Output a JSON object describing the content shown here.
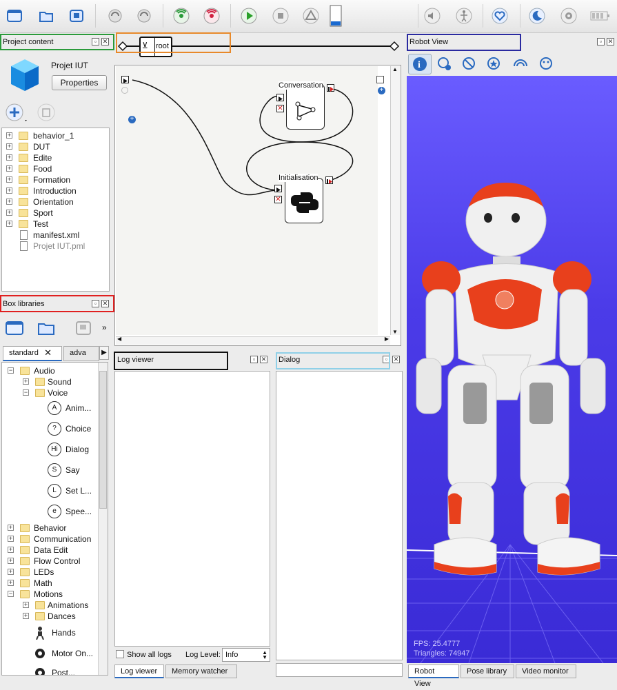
{
  "toolbar": {
    "icons": [
      "window-icon",
      "open-folder-icon",
      "save-icon",
      "undo-icon",
      "redo-icon",
      "connect-icon",
      "disconnect-icon",
      "play-icon",
      "stop-icon",
      "warning-icon",
      "battery-level-icon",
      "volume-icon",
      "posture-icon",
      "heart-icon",
      "moon-icon",
      "gear-icon",
      "battery-icon"
    ]
  },
  "breadcrumb": {
    "root_label": "root"
  },
  "project": {
    "panel_title": "Project content",
    "name": "Projet IUT",
    "properties_label": "Properties",
    "items": [
      {
        "label": "behavior_1",
        "type": "folder"
      },
      {
        "label": "DUT",
        "type": "folder"
      },
      {
        "label": "Edite",
        "type": "folder"
      },
      {
        "label": "Food",
        "type": "folder"
      },
      {
        "label": "Formation",
        "type": "folder"
      },
      {
        "label": "Introduction",
        "type": "folder"
      },
      {
        "label": "Orientation",
        "type": "folder"
      },
      {
        "label": "Sport",
        "type": "folder"
      },
      {
        "label": "Test",
        "type": "folder"
      },
      {
        "label": "manifest.xml",
        "type": "file"
      },
      {
        "label": "Projet IUT.pml",
        "type": "pml"
      }
    ]
  },
  "box_libraries": {
    "panel_title": "Box libraries",
    "tabs": [
      "standard",
      "adva"
    ],
    "audio": "Audio",
    "sound": "Sound",
    "voice": "Voice",
    "voice_items": [
      {
        "label": "Anim...",
        "icon": "A"
      },
      {
        "label": "Choice",
        "icon": "?"
      },
      {
        "label": "Dialog",
        "icon": "Hi"
      },
      {
        "label": "Say",
        "icon": "S"
      },
      {
        "label": "Set L...",
        "icon": "L"
      },
      {
        "label": "Spee...",
        "icon": "e"
      }
    ],
    "categories": [
      "Behavior",
      "Communication",
      "Data Edit",
      "Flow Control",
      "LEDs",
      "Math",
      "Motions"
    ],
    "motions_children": [
      "Animations",
      "Dances"
    ],
    "motion_items": [
      "Hands",
      "Motor On...",
      "Post..."
    ]
  },
  "flow": {
    "box1": "Conversation",
    "box2": "Initialisation"
  },
  "log_viewer": {
    "panel_title": "Log viewer",
    "show_all_logs": "Show all logs",
    "log_level_label": "Log Level:",
    "log_level_value": "Info",
    "tabs": [
      "Log viewer",
      "Memory watcher"
    ]
  },
  "dialog_panel": {
    "panel_title": "Dialog"
  },
  "robot_view": {
    "panel_title": "Robot View",
    "fps": "FPS: 25.4777",
    "triangles": "Triangles: 74947",
    "tabs": [
      "Robot View",
      "Pose library",
      "Video monitor"
    ]
  },
  "colors": {
    "green": "#2a9a3a",
    "orange": "#e8892a",
    "blue": "#2a2aa0",
    "red": "#e02020",
    "lightblue": "#8fd0e8",
    "robot_orange": "#e84020"
  }
}
